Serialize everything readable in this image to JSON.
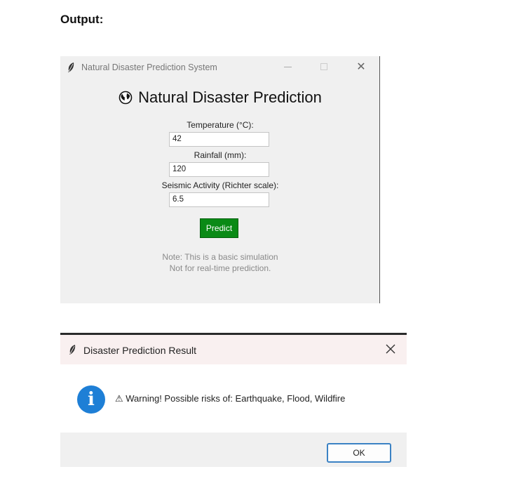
{
  "doc": {
    "heading": "Output:"
  },
  "main_window": {
    "window_title": "Natural Disaster Prediction System",
    "close_glyph": "✕",
    "app_title": "Natural Disaster Prediction",
    "fields": {
      "temperature": {
        "label": "Temperature (°C):",
        "value": "42"
      },
      "rainfall": {
        "label": "Rainfall (mm):",
        "value": "120"
      },
      "seismic": {
        "label": "Seismic Activity (Richter scale):",
        "value": "6.5"
      }
    },
    "predict_label": "Predict",
    "note_line1": "Note: This is a basic simulation",
    "note_line2": "Not for real-time prediction.",
    "colors": {
      "predict_button": "#0a8a16",
      "background": "#f0f0f0"
    },
    "icons": [
      "feather-icon",
      "globe-icon",
      "minimize-icon",
      "maximize-icon",
      "close-icon"
    ]
  },
  "dialog": {
    "title": "Disaster Prediction Result",
    "info_glyph": "i",
    "message": "⚠ Warning! Possible risks of: Earthquake, Flood, Wildfire",
    "ok_label": "OK",
    "colors": {
      "info_icon": "#1e7fd6",
      "ok_border": "#3b82c4"
    },
    "icons": [
      "feather-icon",
      "close-icon",
      "info-icon"
    ]
  }
}
